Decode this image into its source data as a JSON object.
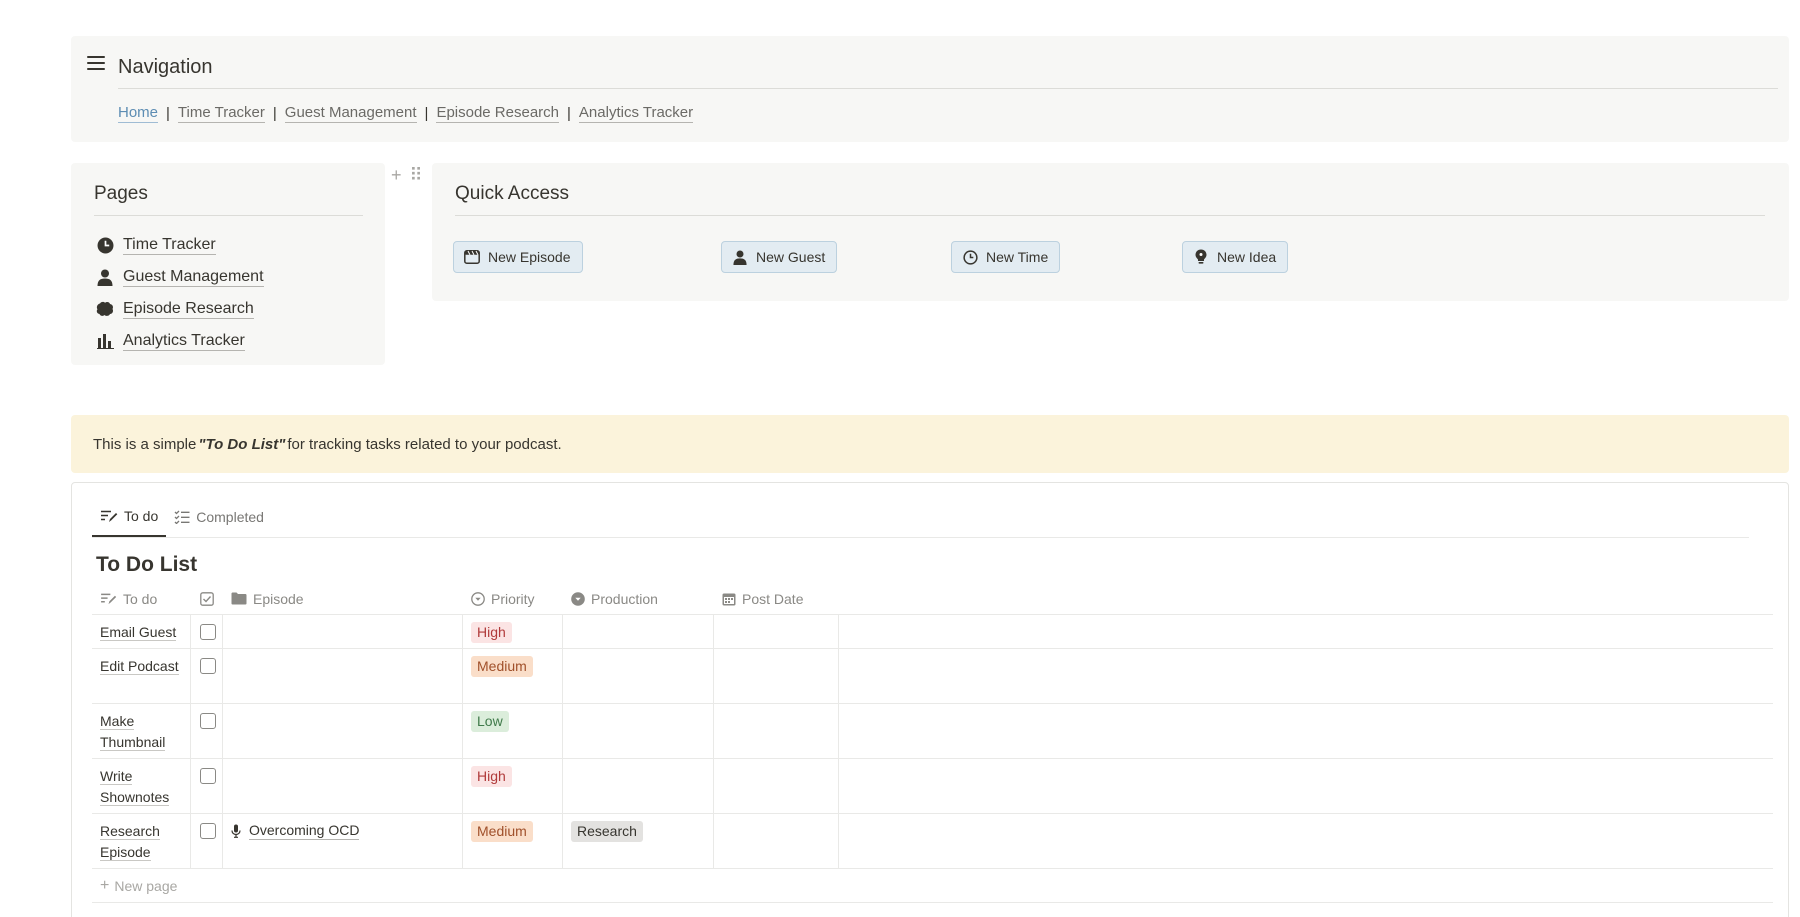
{
  "navigation": {
    "title": "Navigation",
    "links": [
      {
        "label": "Home"
      },
      {
        "label": "Time Tracker"
      },
      {
        "label": "Guest Management"
      },
      {
        "label": "Episode Research"
      },
      {
        "label": "Analytics Tracker"
      }
    ],
    "separator": "|"
  },
  "pages": {
    "title": "Pages",
    "items": [
      {
        "label": "Time Tracker",
        "icon": "clock-icon"
      },
      {
        "label": "Guest Management",
        "icon": "person-icon"
      },
      {
        "label": "Episode Research",
        "icon": "brain-icon"
      },
      {
        "label": "Analytics Tracker",
        "icon": "bar-chart-icon"
      }
    ]
  },
  "block_controls": {
    "add": "+",
    "drag": "⠿"
  },
  "quick_access": {
    "title": "Quick Access",
    "buttons": [
      {
        "label": "New Episode",
        "icon": "clapperboard-icon"
      },
      {
        "label": "New Guest",
        "icon": "person-icon"
      },
      {
        "label": "New Time",
        "icon": "clock-icon"
      },
      {
        "label": "New Idea",
        "icon": "lightbulb-icon"
      }
    ]
  },
  "callout": {
    "prefix": "This is a simple",
    "emphasis": "\"To Do List\"",
    "suffix": "for tracking tasks related to your podcast."
  },
  "database": {
    "tabs": [
      {
        "label": "To do",
        "active": true
      },
      {
        "label": "Completed",
        "active": false
      }
    ],
    "title": "To Do List",
    "columns": {
      "todo": "To do",
      "episode": "Episode",
      "priority": "Priority",
      "production": "Production",
      "post_date": "Post Date"
    },
    "rows": [
      {
        "todo": "Email Guest",
        "done": false,
        "episode": "",
        "priority": "High",
        "production": "",
        "post_date": ""
      },
      {
        "todo": "Edit Podcast",
        "done": false,
        "episode": "",
        "priority": "Medium",
        "production": "",
        "post_date": ""
      },
      {
        "todo": "Make Thumbnail",
        "done": false,
        "episode": "",
        "priority": "Low",
        "production": "",
        "post_date": ""
      },
      {
        "todo": "Write Shownotes",
        "done": false,
        "episode": "",
        "priority": "High",
        "production": "",
        "post_date": ""
      },
      {
        "todo": "Research Episode",
        "done": false,
        "episode": "Overcoming OCD",
        "priority": "Medium",
        "production": "Research",
        "post_date": ""
      }
    ],
    "new_page_label": "New page"
  },
  "colors": {
    "accent_link": "#5d8db3",
    "block_bg": "#f7f7f5",
    "callout_bg": "#fbf3db",
    "quick_button_bg": "#e3ecf2"
  }
}
